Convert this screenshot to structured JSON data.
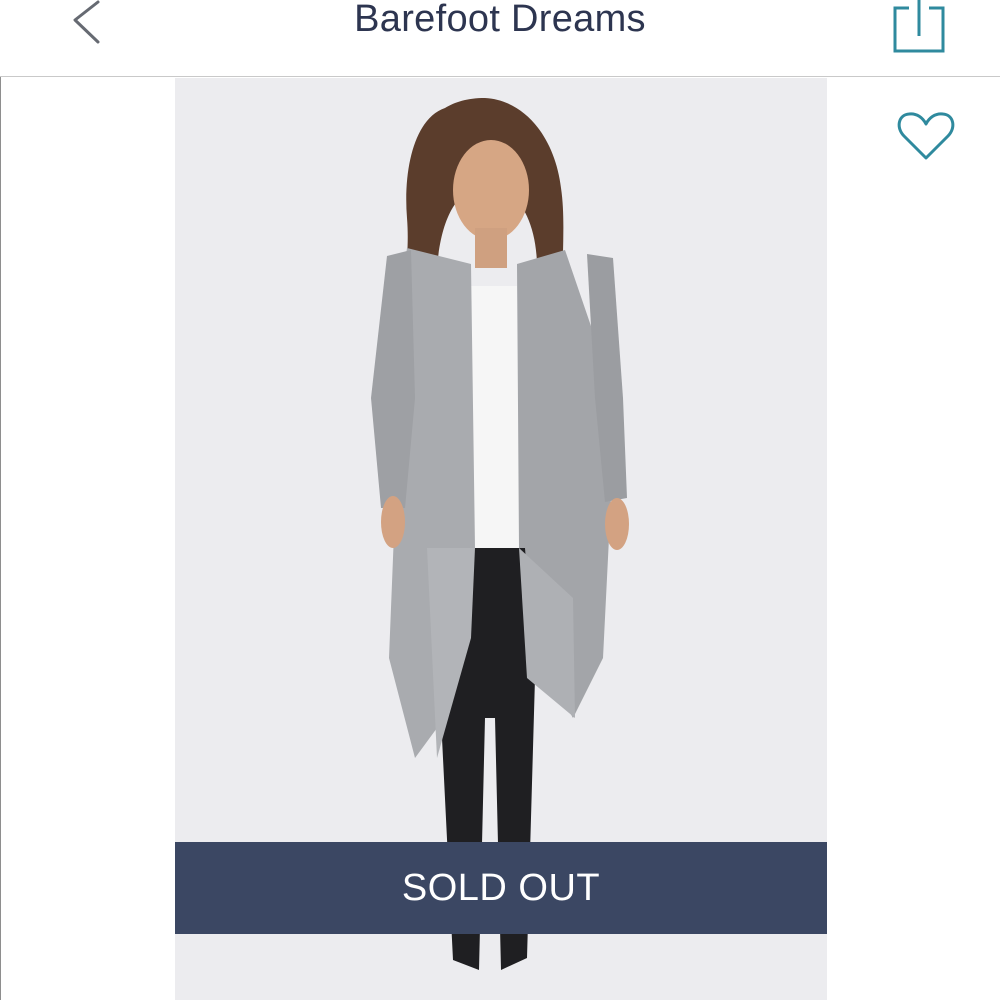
{
  "header": {
    "title": "Barefoot Dreams",
    "back_icon": "chevron-left-icon",
    "share_icon": "share-icon"
  },
  "product": {
    "like_icon": "heart-icon",
    "status_label": "SOLD OUT"
  },
  "colors": {
    "title": "#2d3550",
    "accent": "#2f8a9e",
    "sold_out_bg": "#3b4763",
    "photo_bg": "#ececef"
  }
}
